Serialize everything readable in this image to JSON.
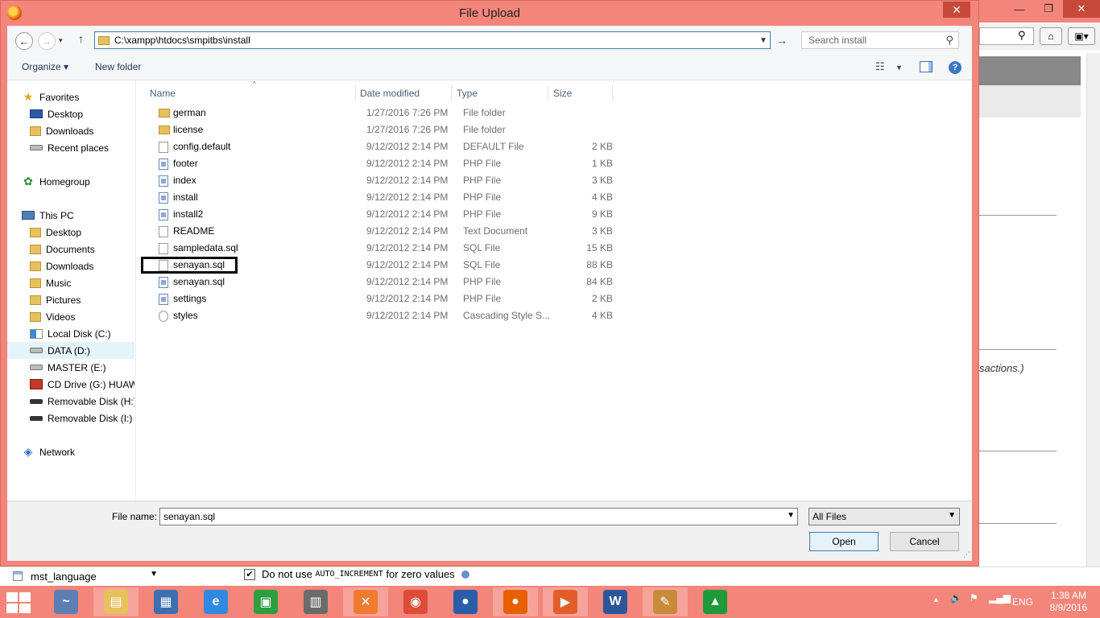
{
  "dialog": {
    "title": "File Upload",
    "address_path": "C:\\xampp\\htdocs\\smpitbs\\install",
    "search_placeholder": "Search install",
    "toolbar": {
      "organize_label": "Organize",
      "new_folder_label": "New folder"
    },
    "nav_pane": [
      {
        "label": "Favorites",
        "icon": "star-icon",
        "kind": "star",
        "indent": 0
      },
      {
        "label": "Desktop",
        "icon": "desktop-icon",
        "kind": "desktop",
        "indent": 1
      },
      {
        "label": "Downloads",
        "icon": "downloads-folder-icon",
        "kind": "dl",
        "indent": 1
      },
      {
        "label": "Recent places",
        "icon": "recent-places-icon",
        "kind": "recent",
        "indent": 1
      },
      {
        "label": "Homegroup",
        "icon": "homegroup-icon",
        "kind": "group",
        "indent": 0
      },
      {
        "label": "This PC",
        "icon": "computer-icon",
        "kind": "pc",
        "indent": 0
      },
      {
        "label": "Desktop",
        "icon": "desktop-folder-icon",
        "kind": "folder",
        "indent": 1
      },
      {
        "label": "Documents",
        "icon": "documents-folder-icon",
        "kind": "folder",
        "indent": 1
      },
      {
        "label": "Downloads",
        "icon": "downloads-folder-icon",
        "kind": "folder",
        "indent": 1
      },
      {
        "label": "Music",
        "icon": "music-folder-icon",
        "kind": "folder",
        "indent": 1
      },
      {
        "label": "Pictures",
        "icon": "pictures-folder-icon",
        "kind": "folder",
        "indent": 1
      },
      {
        "label": "Videos",
        "icon": "videos-folder-icon",
        "kind": "folder",
        "indent": 1
      },
      {
        "label": "Local Disk (C:)",
        "icon": "windows-drive-icon",
        "kind": "win",
        "indent": 1
      },
      {
        "label": "DATA (D:)",
        "icon": "drive-icon",
        "kind": "disk",
        "indent": 1,
        "selected": true
      },
      {
        "label": "MASTER (E:)",
        "icon": "drive-icon",
        "kind": "disk",
        "indent": 1
      },
      {
        "label": "CD Drive (G:) HUAWEI",
        "icon": "cd-drive-icon",
        "kind": "cd",
        "indent": 1
      },
      {
        "label": "Removable Disk (H:)",
        "icon": "removable-disk-icon",
        "kind": "usb",
        "indent": 1
      },
      {
        "label": "Removable Disk (I:)",
        "icon": "removable-disk-icon",
        "kind": "usb",
        "indent": 1
      },
      {
        "label": "Network",
        "icon": "network-icon",
        "kind": "net",
        "indent": 0
      }
    ],
    "columns": {
      "name": "Name",
      "date": "Date modified",
      "type": "Type",
      "size": "Size"
    },
    "files": [
      {
        "name": "german",
        "date": "1/27/2016 7:26 PM",
        "type": "File folder",
        "size": "",
        "icon": "folder-icon",
        "kind": "folder"
      },
      {
        "name": "license",
        "date": "1/27/2016 7:26 PM",
        "type": "File folder",
        "size": "",
        "icon": "folder-icon",
        "kind": "folder"
      },
      {
        "name": "config.default",
        "date": "9/12/2012 2:14 PM",
        "type": "DEFAULT File",
        "size": "2 KB",
        "icon": "file-icon",
        "kind": "doc"
      },
      {
        "name": "footer",
        "date": "9/12/2012 2:14 PM",
        "type": "PHP File",
        "size": "1 KB",
        "icon": "php-file-icon",
        "kind": "php"
      },
      {
        "name": "index",
        "date": "9/12/2012 2:14 PM",
        "type": "PHP File",
        "size": "3 KB",
        "icon": "php-file-icon",
        "kind": "php"
      },
      {
        "name": "install",
        "date": "9/12/2012 2:14 PM",
        "type": "PHP File",
        "size": "4 KB",
        "icon": "php-file-icon",
        "kind": "php"
      },
      {
        "name": "install2",
        "date": "9/12/2012 2:14 PM",
        "type": "PHP File",
        "size": "9 KB",
        "icon": "php-file-icon",
        "kind": "php"
      },
      {
        "name": "README",
        "date": "9/12/2012 2:14 PM",
        "type": "Text Document",
        "size": "3 KB",
        "icon": "text-file-icon",
        "kind": "doc"
      },
      {
        "name": "sampledata.sql",
        "date": "9/12/2012 2:14 PM",
        "type": "SQL File",
        "size": "15 KB",
        "icon": "sql-file-icon",
        "kind": "doc"
      },
      {
        "name": "senayan.sql",
        "date": "9/12/2012 2:14 PM",
        "type": "SQL File",
        "size": "88 KB",
        "icon": "sql-file-icon",
        "kind": "doc"
      },
      {
        "name": "senayan.sql",
        "date": "9/12/2012 2:14 PM",
        "type": "PHP File",
        "size": "84 KB",
        "icon": "php-file-icon",
        "kind": "php"
      },
      {
        "name": "settings",
        "date": "9/12/2012 2:14 PM",
        "type": "PHP File",
        "size": "2 KB",
        "icon": "php-file-icon",
        "kind": "php"
      },
      {
        "name": "styles",
        "date": "9/12/2012 2:14 PM",
        "type": "Cascading Style S...",
        "size": "4 KB",
        "icon": "css-file-icon",
        "kind": "css"
      }
    ],
    "file_name_label": "File name:",
    "file_name_value": "senayan.sql",
    "file_type_value": "All Files",
    "open_label": "Open",
    "cancel_label": "Cancel"
  },
  "background": {
    "italic_text": "sactions.)",
    "table_select_value": "mst_language",
    "checkbox_label_prefix": "Do not use",
    "checkbox_label_code": "AUTO_INCREMENT",
    "checkbox_label_suffix": "for zero values"
  },
  "taskbar": {
    "apps": [
      {
        "name": "performance-monitor",
        "color": "#5b7fb3",
        "glyph": "~"
      },
      {
        "name": "file-explorer",
        "color": "#e8c15d",
        "glyph": "▤",
        "active": true
      },
      {
        "name": "control-panel",
        "color": "#3b6fb0",
        "glyph": "▦"
      },
      {
        "name": "internet-explorer",
        "color": "#2f8ae0",
        "glyph": "e"
      },
      {
        "name": "store",
        "color": "#2e9e3f",
        "glyph": "▣"
      },
      {
        "name": "firewall",
        "color": "#6b6b6b",
        "glyph": "▥"
      },
      {
        "name": "xampp",
        "color": "#f07a2e",
        "glyph": "✕",
        "active": true
      },
      {
        "name": "chrome",
        "color": "#dd4b39",
        "glyph": "◉"
      },
      {
        "name": "thunderbird",
        "color": "#2a5da8",
        "glyph": "●"
      },
      {
        "name": "firefox",
        "color": "#e66000",
        "glyph": "●",
        "active": true
      },
      {
        "name": "media-player",
        "color": "#e35d2a",
        "glyph": "▶",
        "active": true
      },
      {
        "name": "word",
        "color": "#2b579a",
        "glyph": "W"
      },
      {
        "name": "paint",
        "color": "#c98a3a",
        "glyph": "✎",
        "active": true
      },
      {
        "name": "calibre-app",
        "color": "#1e9a3a",
        "glyph": "▲"
      }
    ],
    "language": "ENG",
    "time": "1:38 AM",
    "date": "8/9/2016"
  }
}
